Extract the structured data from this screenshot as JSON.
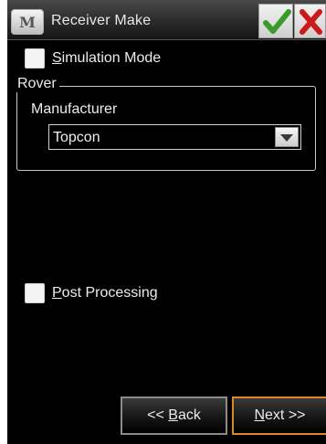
{
  "window": {
    "title": "Receiver Make",
    "app_icon_glyph": "M",
    "ok_icon": "checkmark-icon",
    "close_icon": "close-x-icon",
    "accent_ok": "#3a9a2a",
    "accent_close": "#cc1a1a"
  },
  "simulation_mode": {
    "mnemonic": "S",
    "label_rest": "imulation Mode",
    "checked": false
  },
  "rover": {
    "group_label": "Rover",
    "manufacturer_label": "Manufacturer",
    "manufacturer_value": "Topcon"
  },
  "post_processing": {
    "mnemonic": "P",
    "label_rest": "ost Processing",
    "checked": false
  },
  "buttons": {
    "back_prefix": "<< ",
    "back_mnemonic": "B",
    "back_rest": "ack",
    "next_mnemonic": "N",
    "next_rest": "ext >>",
    "next_border_color": "#d8892a"
  }
}
